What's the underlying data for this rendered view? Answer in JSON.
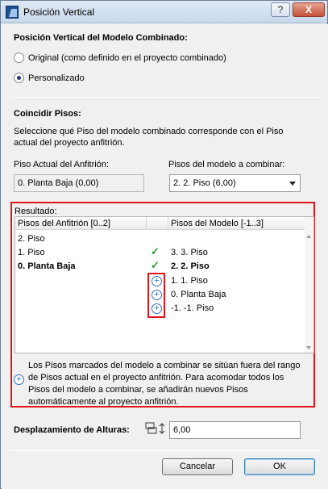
{
  "window": {
    "title": "Posición Vertical",
    "help_label": "?",
    "close_label": "X"
  },
  "vertical": {
    "heading": "Posición Vertical del Modelo Combinado:",
    "option_original": "Original (como definido en el proyecto combinado)",
    "option_custom": "Personalizado",
    "selected": "Personalizado"
  },
  "match": {
    "heading": "Coincidir Pisos:",
    "description_line1": "Seleccione qué Piso del modelo combinado corresponde con el Piso",
    "description_line2": "actual del proyecto anfitrión.",
    "host_label": "Piso Actual del Anfitrión:",
    "host_value": "0. Planta Baja (0,00)",
    "model_label": "Pisos del modelo a combinar:",
    "model_value": "2. 2. Piso (6,00)"
  },
  "result": {
    "label": "Resultado:",
    "col_host": "Pisos del Anfitrión [0..2]",
    "col_model": "Pisos del Modelo [-1..3]",
    "rows": [
      {
        "host": "2. Piso",
        "status": "",
        "model": ""
      },
      {
        "host": "1. Piso",
        "status": "check",
        "model": "3. 3. Piso"
      },
      {
        "host": "0. Planta Baja",
        "status": "check",
        "model": "2. 2. Piso"
      },
      {
        "host": "",
        "status": "add",
        "model": "1. 1. Piso"
      },
      {
        "host": "",
        "status": "add",
        "model": "0. Planta Baja"
      },
      {
        "host": "",
        "status": "add",
        "model": "-1. -1. Piso"
      }
    ],
    "note": "Los Pisos marcados del modelo a combinar se sitúan fuera del rango de Pisos actual en el proyecto anfitrión. Para acomodar todos los Pisos del modelo a combinar, se añadirán nuevos Pisos automáticamente al proyecto anfitrión."
  },
  "offset": {
    "label": "Desplazamiento de Alturas:",
    "value": "6,00"
  },
  "buttons": {
    "cancel": "Cancelar",
    "ok": "OK"
  },
  "colors": {
    "highlight_frame": "#e0151a",
    "check": "#2a9a2a",
    "add_icon": "#2f6fc7"
  }
}
